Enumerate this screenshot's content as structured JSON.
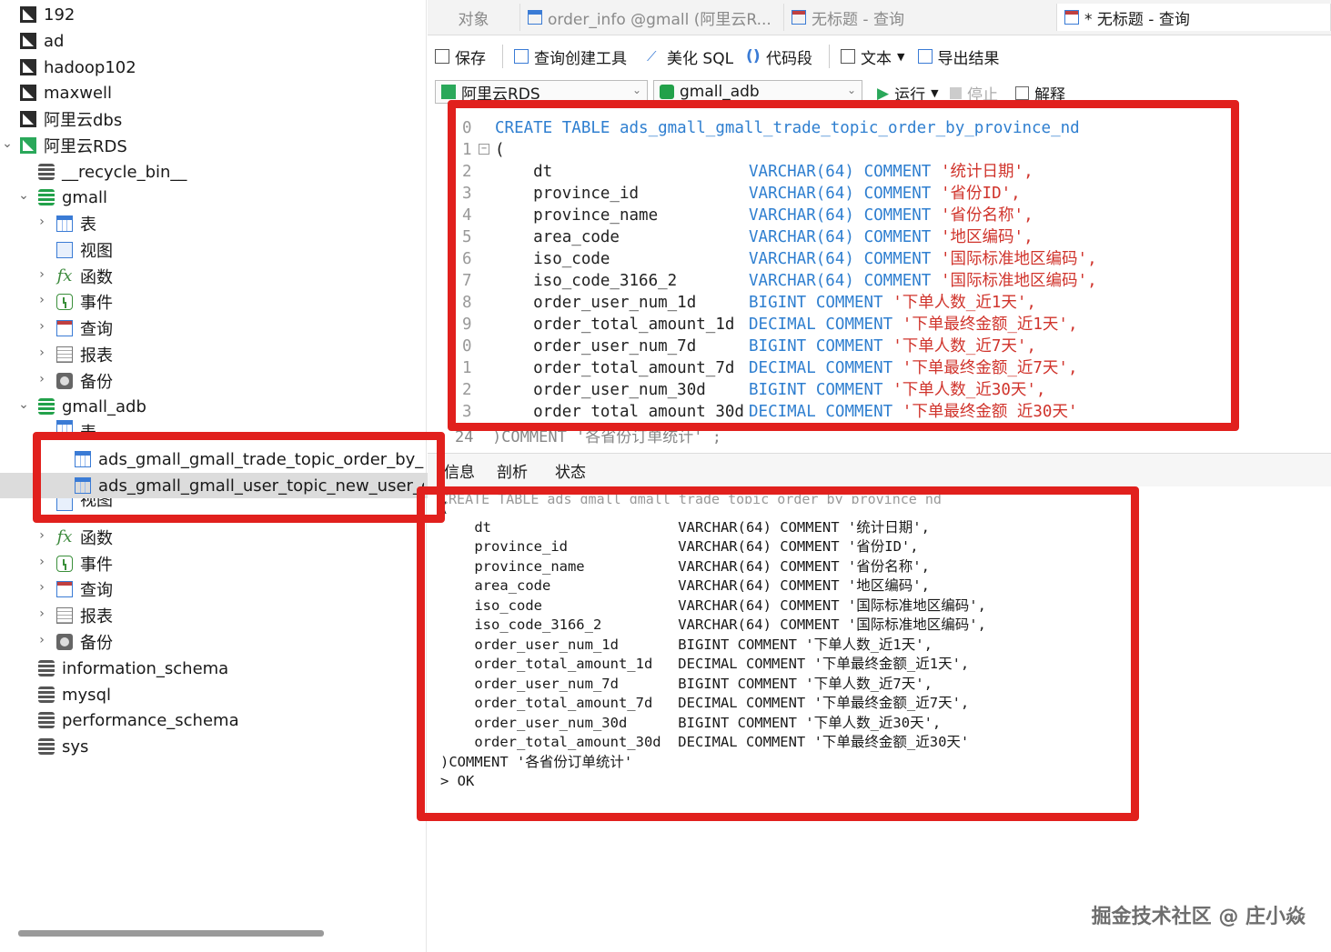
{
  "sidebar": {
    "items": [
      {
        "label": "192"
      },
      {
        "label": "ad"
      },
      {
        "label": "hadoop102"
      },
      {
        "label": "maxwell"
      },
      {
        "label": "阿里云dbs"
      },
      {
        "label": "阿里云RDS"
      },
      {
        "label": "__recycle_bin__"
      },
      {
        "label": "gmall"
      },
      {
        "label": "表"
      },
      {
        "label": "视图"
      },
      {
        "label": "函数"
      },
      {
        "label": "事件"
      },
      {
        "label": "查询"
      },
      {
        "label": "报表"
      },
      {
        "label": "备份"
      },
      {
        "label": "gmall_adb"
      },
      {
        "label": "表"
      },
      {
        "label": "ads_gmall_gmall_trade_topic_order_by_province_nd"
      },
      {
        "label": "ads_gmall_gmall_user_topic_new_user_order_nd"
      },
      {
        "label": "视图"
      },
      {
        "label": "函数"
      },
      {
        "label": "事件"
      },
      {
        "label": "查询"
      },
      {
        "label": "报表"
      },
      {
        "label": "备份"
      },
      {
        "label": "information_schema"
      },
      {
        "label": "mysql"
      },
      {
        "label": "performance_schema"
      },
      {
        "label": "sys"
      }
    ]
  },
  "tabs": [
    {
      "label": "对象"
    },
    {
      "label": "order_info @gmall (阿里云R..."
    },
    {
      "label": "无标题 - 查询"
    },
    {
      "label": "* 无标题 - 查询"
    }
  ],
  "toolbar": {
    "save": "保存",
    "query_builder": "查询创建工具",
    "beautify": "美化 SQL",
    "snippet": "代码段",
    "text": "文本",
    "export": "导出结果"
  },
  "connection_select": "阿里云RDS",
  "database_select": "gmall_adb",
  "run_label": "运行",
  "stop_label": "停止",
  "explain_label": "解释",
  "editor": {
    "lines": [
      {
        "n": "0",
        "name": "CREATE TABLE ads_gmall_gmall_trade_topic_order_by_province_nd",
        "type": "",
        "cmt": "",
        "text": ""
      },
      {
        "n": "1",
        "name": "(",
        "type": "",
        "cmt": "",
        "text": ""
      },
      {
        "n": "2",
        "name": "    dt",
        "type": "VARCHAR(64)",
        "cmt": "COMMENT",
        "text": "'统计日期',"
      },
      {
        "n": "3",
        "name": "    province_id",
        "type": "VARCHAR(64)",
        "cmt": "COMMENT",
        "text": "'省份ID',"
      },
      {
        "n": "4",
        "name": "    province_name",
        "type": "VARCHAR(64)",
        "cmt": "COMMENT",
        "text": "'省份名称',"
      },
      {
        "n": "5",
        "name": "    area_code",
        "type": "VARCHAR(64)",
        "cmt": "COMMENT",
        "text": "'地区编码',"
      },
      {
        "n": "6",
        "name": "    iso_code",
        "type": "VARCHAR(64)",
        "cmt": "COMMENT",
        "text": "'国际标准地区编码',"
      },
      {
        "n": "7",
        "name": "    iso_code_3166_2",
        "type": "VARCHAR(64)",
        "cmt": "COMMENT",
        "text": "'国际标准地区编码',"
      },
      {
        "n": "8",
        "name": "    order_user_num_1d",
        "type": "BIGINT",
        "cmt": "COMMENT",
        "text": "'下单人数_近1天',"
      },
      {
        "n": "9",
        "name": "    order_total_amount_1d",
        "type": "DECIMAL",
        "cmt": "COMMENT",
        "text": "'下单最终金额_近1天',"
      },
      {
        "n": "0",
        "name": "    order_user_num_7d",
        "type": "BIGINT",
        "cmt": "COMMENT",
        "text": "'下单人数_近7天',"
      },
      {
        "n": "1",
        "name": "    order_total_amount_7d",
        "type": "DECIMAL",
        "cmt": "COMMENT",
        "text": "'下单最终金额_近7天',"
      },
      {
        "n": "2",
        "name": "    order_user_num_30d",
        "type": "BIGINT",
        "cmt": "COMMENT",
        "text": "'下单人数_近30天',"
      },
      {
        "n": "3",
        "name": "    order_total_amount_30d",
        "type": "DECIMAL",
        "cmt": "COMMENT",
        "text": "'下单最终金额_近30天'"
      }
    ],
    "ghost": "24  )COMMENT '各省份订单统计' ;"
  },
  "result_tabs": [
    {
      "label": "信息"
    },
    {
      "label": "剖析"
    },
    {
      "label": "状态"
    }
  ],
  "output": {
    "ghost_top": "CREATE TABLE ads_gmall_gmall_trade_topic_order_by_province_nd",
    "lines": [
      "(",
      "    dt                      VARCHAR(64) COMMENT '统计日期',",
      "    province_id             VARCHAR(64) COMMENT '省份ID',",
      "    province_name           VARCHAR(64) COMMENT '省份名称',",
      "    area_code               VARCHAR(64) COMMENT '地区编码',",
      "    iso_code                VARCHAR(64) COMMENT '国际标准地区编码',",
      "    iso_code_3166_2         VARCHAR(64) COMMENT '国际标准地区编码',",
      "    order_user_num_1d       BIGINT COMMENT '下单人数_近1天',",
      "    order_total_amount_1d   DECIMAL COMMENT '下单最终金额_近1天',",
      "    order_user_num_7d       BIGINT COMMENT '下单人数_近7天',",
      "    order_total_amount_7d   DECIMAL COMMENT '下单最终金额_近7天',",
      "    order_user_num_30d      BIGINT COMMENT '下单人数_近30天',",
      "    order_total_amount_30d  DECIMAL COMMENT '下单最终金额_近30天'",
      ")COMMENT '各省份订单统计'",
      "> OK"
    ]
  },
  "watermark": "掘金技术社区 @ 庄小焱",
  "colors": {
    "highlight": "#e1201d",
    "keyword": "#2f7fd0",
    "string": "#d0342c"
  }
}
